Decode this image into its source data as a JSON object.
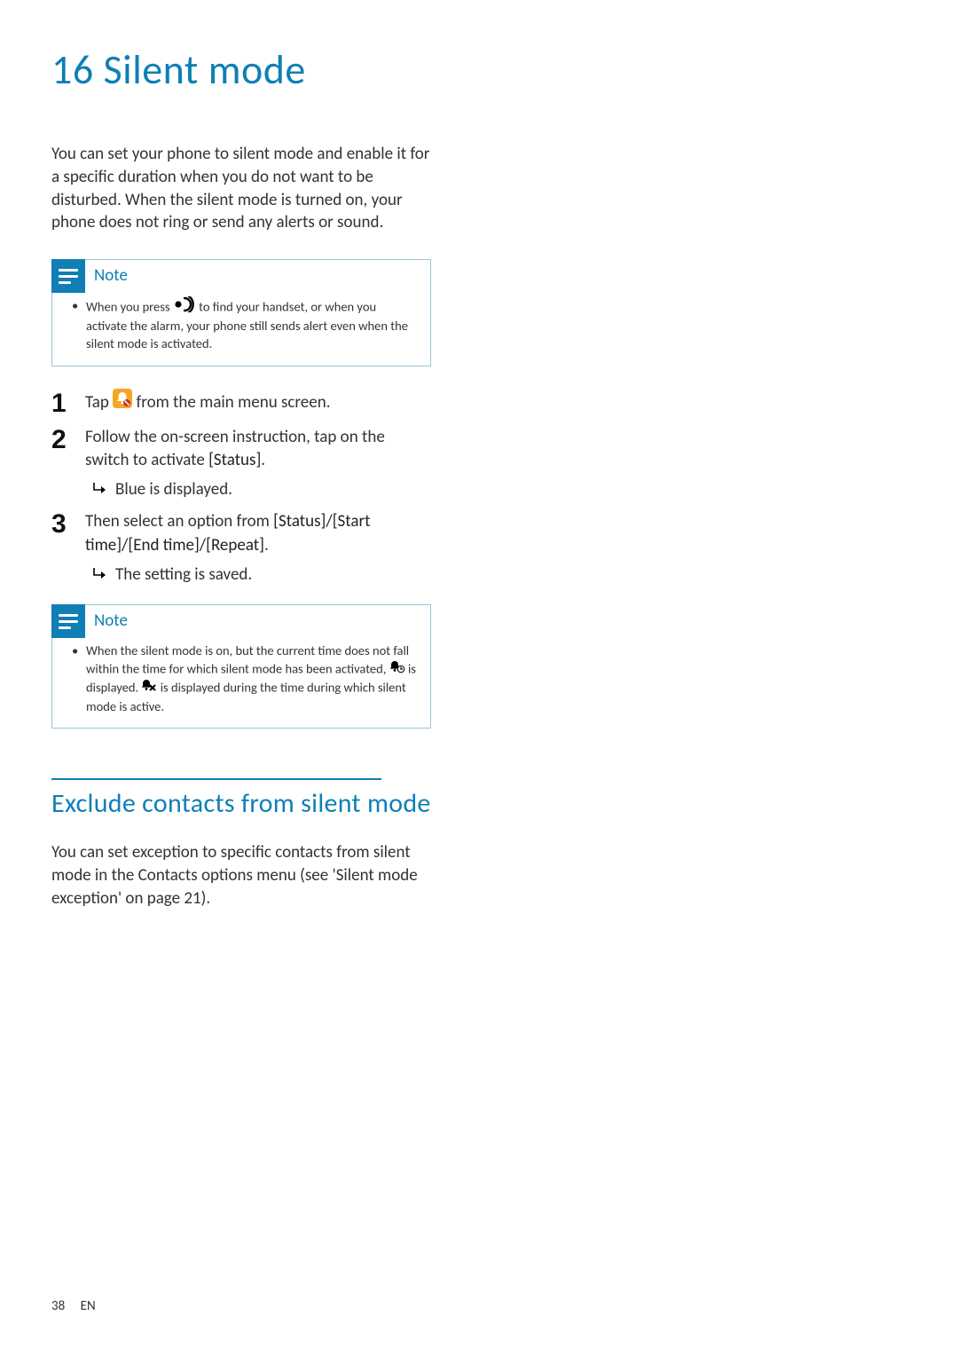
{
  "chapter": {
    "number": "16",
    "title": "Silent mode"
  },
  "intro": "You can set your phone to silent mode and enable it for a specific duration when you do not want to be disturbed. When the silent mode is turned on, your phone does not ring or send any alerts or sound.",
  "note1": {
    "label": "Note",
    "text_before_icon": "When you press ",
    "text_after_icon": " to find your handset, or when you activate the alarm, your phone still sends alert even when the silent mode is activated."
  },
  "steps": [
    {
      "num": "1",
      "pre_icon": "Tap ",
      "post_icon": " from the main menu screen.",
      "result": null
    },
    {
      "num": "2",
      "text": "Follow the on-screen instruction, tap on the switch to activate ",
      "bold": "[Status]",
      "suffix": ".",
      "result": "Blue is displayed."
    },
    {
      "num": "3",
      "text": "Then select an option from ",
      "bold": "[Status]/[Start time]/[End time]/[Repeat]",
      "suffix": ".",
      "result": "The setting is saved."
    }
  ],
  "note2": {
    "label": "Note",
    "p1": "When the silent mode is on, but the current time does not fall within the time for which silent mode has been activated, ",
    "p2": " is displayed. ",
    "p3": " is displayed during the time during which silent mode is active."
  },
  "section2": {
    "title": "Exclude contacts from silent mode",
    "body": "You can set exception to specific contacts from silent mode in the Contacts options menu (see 'Silent mode exception' on page 21)."
  },
  "footer": {
    "page": "38",
    "lang": "EN"
  }
}
